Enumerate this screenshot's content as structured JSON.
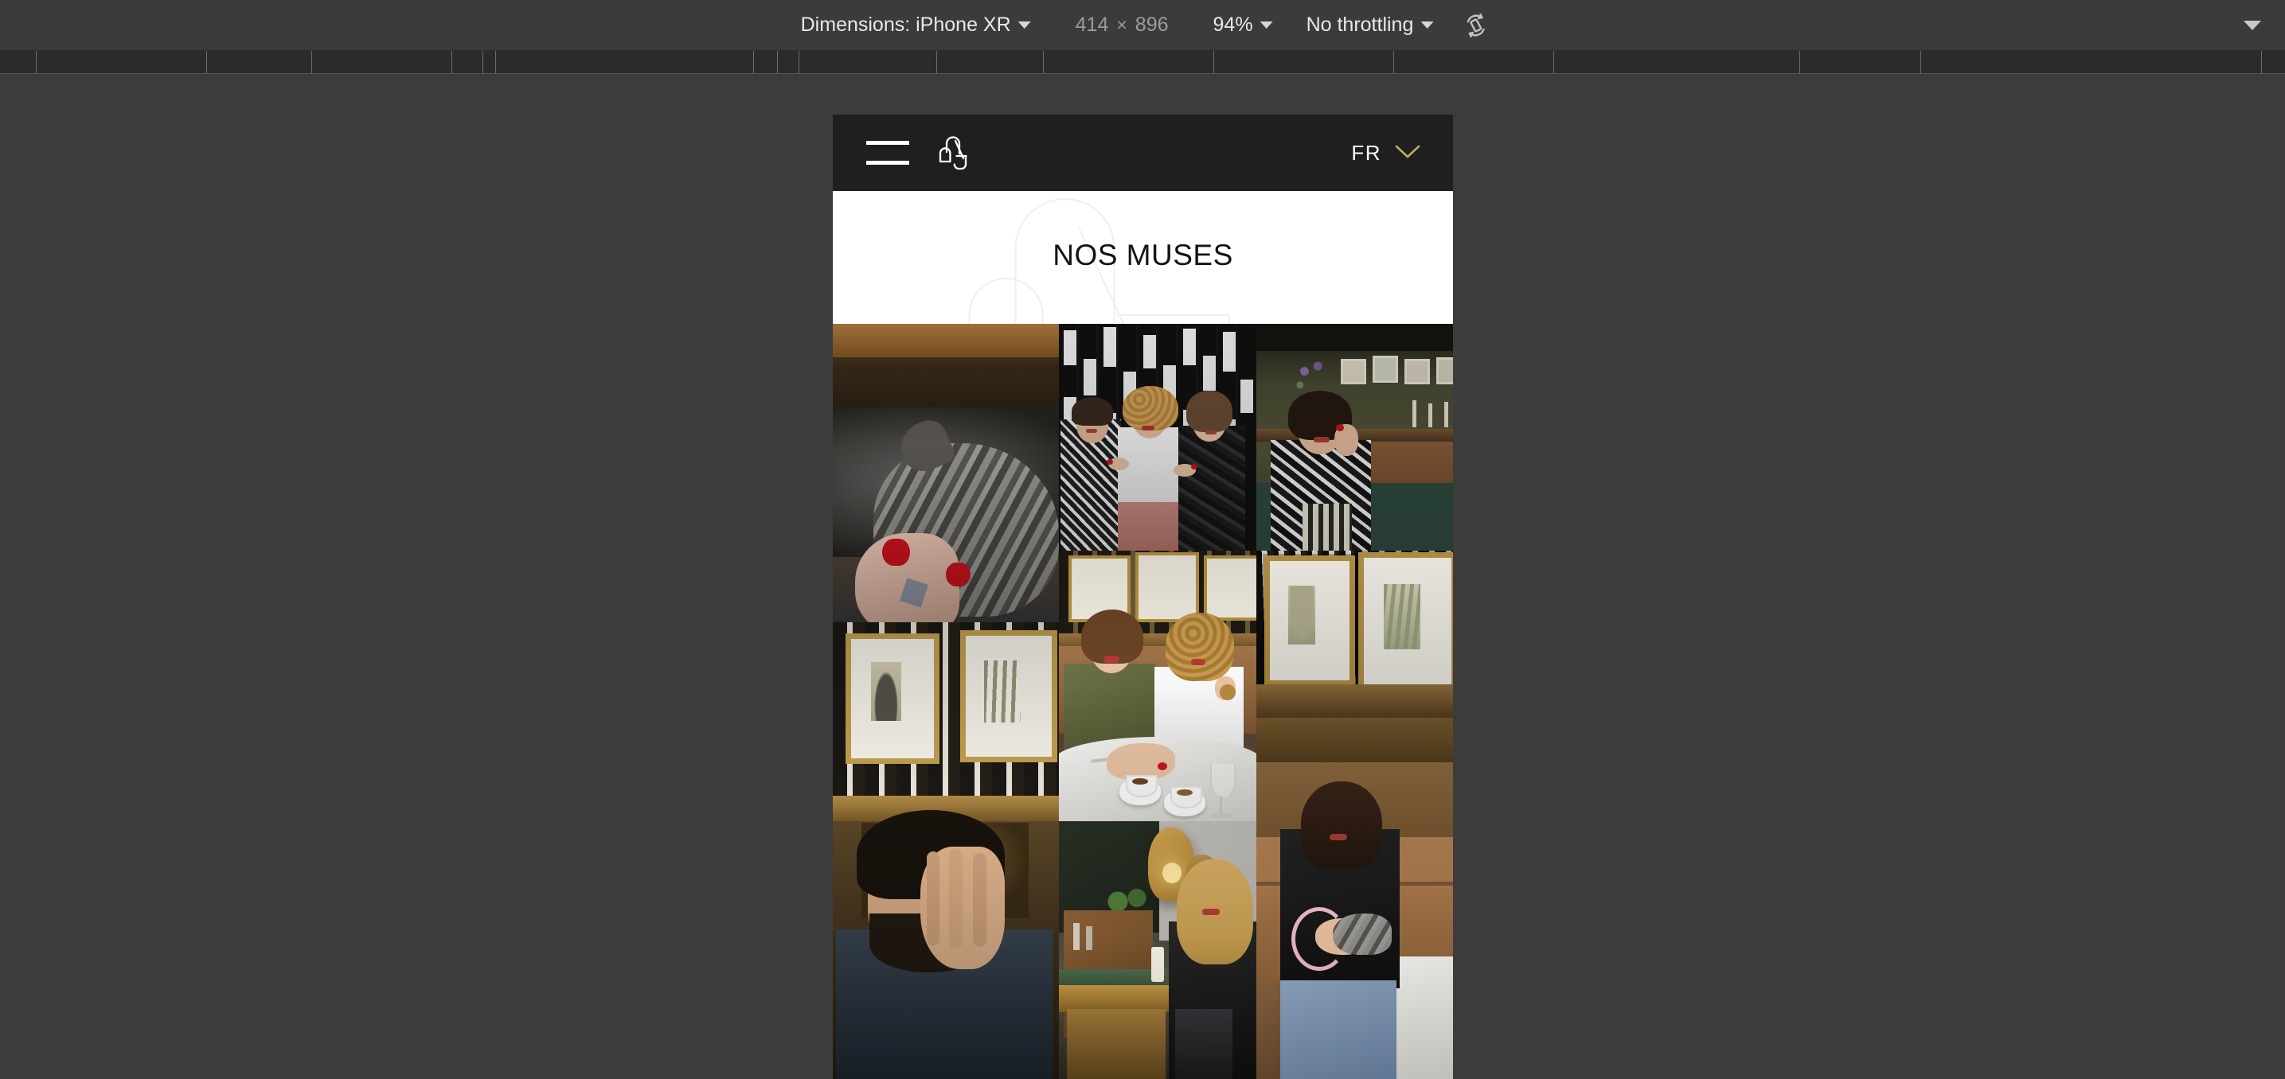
{
  "devtools": {
    "dimensions_label": "Dimensions: iPhone XR",
    "width_value": "414",
    "multiply_symbol": "×",
    "height_value": "896",
    "zoom_value": "94%",
    "throttling_value": "No throttling",
    "rotate_icon": "rotate-device-icon",
    "more_options_icon": "chevron-down-icon",
    "caret_icon": "chevron-down-icon",
    "toolbar_bg": "#3b3b3b",
    "ruler_bg": "#2b2b2b",
    "page_bg": "#3c3c3c",
    "ruler_ticks": [
      45,
      259,
      391,
      567,
      606,
      622,
      946,
      976,
      1003,
      1176,
      1310,
      1524,
      1750,
      1951,
      2260,
      2412,
      2840
    ]
  },
  "site": {
    "header": {
      "menu_icon": "hamburger-menu-icon",
      "logo_icon": "brand-monogram-logo",
      "language_code": "FR",
      "language_caret_icon": "chevron-down-icon",
      "bg_color": "#1f1f1f",
      "accent_color": "#c9a961"
    },
    "hero": {
      "title": "NOS MUSES",
      "watermark_icon": "brand-monogram-watermark",
      "bg_color": "#ffffff",
      "title_color": "#141414"
    },
    "gallery": {
      "tiles": [
        {
          "id": "tile-cat-hands",
          "alt": "Woman with red nails holding a grey tabby cat"
        },
        {
          "id": "tile-three-women",
          "alt": "Three women posing against black and white tiled wall"
        },
        {
          "id": "tile-woman-green-wall",
          "alt": "Smiling woman with dark bob in patterned blouse by green wall"
        },
        {
          "id": "tile-two-women-table",
          "alt": "Two women laughing at marble cafe table with coffee cups"
        },
        {
          "id": "tile-framed-prints",
          "alt": "Gold framed botanical prints on patterned wallpaper"
        },
        {
          "id": "tile-woman-banquette",
          "alt": "Woman in black jacket seated on leather banquette"
        },
        {
          "id": "tile-man-hand-face",
          "alt": "Bearded man covering his face with his hand"
        },
        {
          "id": "tile-blonde-lamp",
          "alt": "Blonde woman beside brass pendant lamp and shelving"
        }
      ]
    }
  }
}
